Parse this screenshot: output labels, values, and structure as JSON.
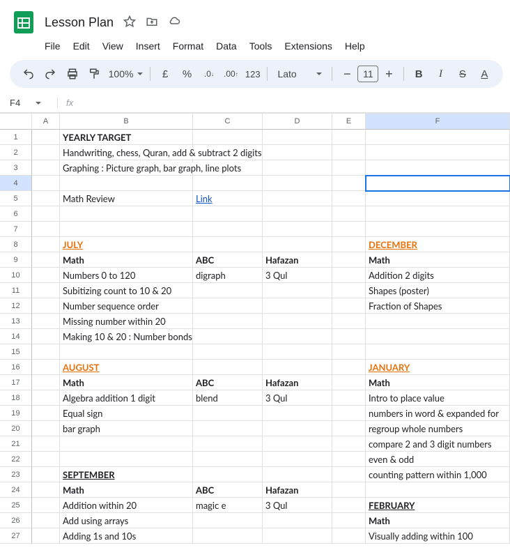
{
  "title": "Lesson Plan",
  "menus": [
    "File",
    "Edit",
    "View",
    "Insert",
    "Format",
    "Data",
    "Tools",
    "Extensions",
    "Help"
  ],
  "toolbar": {
    "zoom": "100%",
    "font": "Lato",
    "font_size": "11"
  },
  "formula": {
    "cell_ref": "F4",
    "fx": "fx"
  },
  "columns": [
    "A",
    "B",
    "C",
    "D",
    "E",
    "F"
  ],
  "selected_col": "F",
  "selected_row": "4",
  "selected_cell": "F4",
  "rows": [
    {
      "n": "1",
      "A": "",
      "B": "YEARLY TARGET",
      "B_cls": "bold",
      "C": "",
      "D": "",
      "E": "",
      "F": ""
    },
    {
      "n": "2",
      "A": "",
      "B": "Handwriting, chess, Quran, add & subtract 2 digits",
      "B_overflow": true,
      "C": "",
      "D": "",
      "E": "",
      "F": ""
    },
    {
      "n": "3",
      "A": "",
      "B": "Graphing : Picture graph, bar graph, line plots",
      "B_overflow": true,
      "C": "",
      "D": "",
      "E": "",
      "F": ""
    },
    {
      "n": "4",
      "A": "",
      "B": "",
      "C": "",
      "D": "",
      "E": "",
      "F": ""
    },
    {
      "n": "5",
      "A": "",
      "B": "Math Review",
      "C": "Link",
      "C_cls": "link",
      "D": "",
      "E": "",
      "F": ""
    },
    {
      "n": "6",
      "A": "",
      "B": "",
      "C": "",
      "D": "",
      "E": "",
      "F": ""
    },
    {
      "n": "7",
      "A": "",
      "B": "",
      "C": "",
      "D": "",
      "E": "",
      "F": ""
    },
    {
      "n": "8",
      "A": "",
      "B": "JULY",
      "B_cls": "month-header",
      "C": "",
      "D": "",
      "E": "",
      "F": "DECEMBER",
      "F_cls": "month-header"
    },
    {
      "n": "9",
      "A": "",
      "B": "Math",
      "B_cls": "bold",
      "C": "ABC",
      "C_cls": "bold",
      "D": "Hafazan",
      "D_cls": "bold",
      "E": "",
      "F": "Math",
      "F_cls": "bold"
    },
    {
      "n": "10",
      "A": "",
      "B": "Numbers 0 to 120",
      "C": "digraph",
      "D": "3 Qul",
      "E": "",
      "F": "Addition 2 digits"
    },
    {
      "n": "11",
      "A": "",
      "B": "Subitizing count to 10 & 20",
      "C": "",
      "D": "",
      "E": "",
      "F": "Shapes (poster)"
    },
    {
      "n": "12",
      "A": "",
      "B": "Number sequence order",
      "C": "",
      "D": "",
      "E": "",
      "F": "Fraction of Shapes"
    },
    {
      "n": "13",
      "A": "",
      "B": "Missing number within 20",
      "C": "",
      "D": "",
      "E": "",
      "F": ""
    },
    {
      "n": "14",
      "A": "",
      "B": "Making 10 & 20 : Number bonds",
      "C": "",
      "D": "",
      "E": "",
      "F": ""
    },
    {
      "n": "15",
      "A": "",
      "B": "",
      "C": "",
      "D": "",
      "E": "",
      "F": ""
    },
    {
      "n": "16",
      "A": "",
      "B": "AUGUST",
      "B_cls": "month-header",
      "C": "",
      "D": "",
      "E": "",
      "F": "JANUARY",
      "F_cls": "month-header"
    },
    {
      "n": "17",
      "A": "",
      "B": "Math",
      "B_cls": "bold",
      "C": "ABC",
      "C_cls": "bold",
      "D": "Hafazan",
      "D_cls": "bold",
      "E": "",
      "F": "Math",
      "F_cls": "bold"
    },
    {
      "n": "18",
      "A": "",
      "B": "Algebra addition 1 digit",
      "C": "blend",
      "D": "3 Qul",
      "E": "",
      "F": "Intro to place value"
    },
    {
      "n": "19",
      "A": "",
      "B": "Equal sign",
      "C": "",
      "D": "",
      "E": "",
      "F": "numbers in word & expanded for"
    },
    {
      "n": "20",
      "A": "",
      "B": "bar graph",
      "C": "",
      "D": "",
      "E": "",
      "F": "regroup whole numbers"
    },
    {
      "n": "21",
      "A": "",
      "B": "",
      "C": "",
      "D": "",
      "E": "",
      "F": "compare 2 and 3 digit numbers"
    },
    {
      "n": "22",
      "A": "",
      "B": "",
      "C": "",
      "D": "",
      "E": "",
      "F": "even & odd"
    },
    {
      "n": "23",
      "A": "",
      "B": "SEPTEMBER",
      "B_cls": "black-underline",
      "C": "",
      "D": "",
      "E": "",
      "F": "counting pattern within 1,000"
    },
    {
      "n": "24",
      "A": "",
      "B": "Math",
      "B_cls": "bold",
      "C": "ABC",
      "C_cls": "bold",
      "D": "Hafazan",
      "D_cls": "bold",
      "E": "",
      "F": ""
    },
    {
      "n": "25",
      "A": "",
      "B": "Addition within 20",
      "C": "magic e",
      "D": "3 Qul",
      "E": "",
      "F": "FEBRUARY",
      "F_cls": "black-underline"
    },
    {
      "n": "26",
      "A": "",
      "B": "Add using arrays",
      "C": "",
      "D": "",
      "E": "",
      "F": "Math",
      "F_cls": "bold"
    },
    {
      "n": "27",
      "A": "",
      "B": "Adding 1s and 10s",
      "C": "",
      "D": "",
      "E": "",
      "F": "Visually adding within 100"
    }
  ]
}
